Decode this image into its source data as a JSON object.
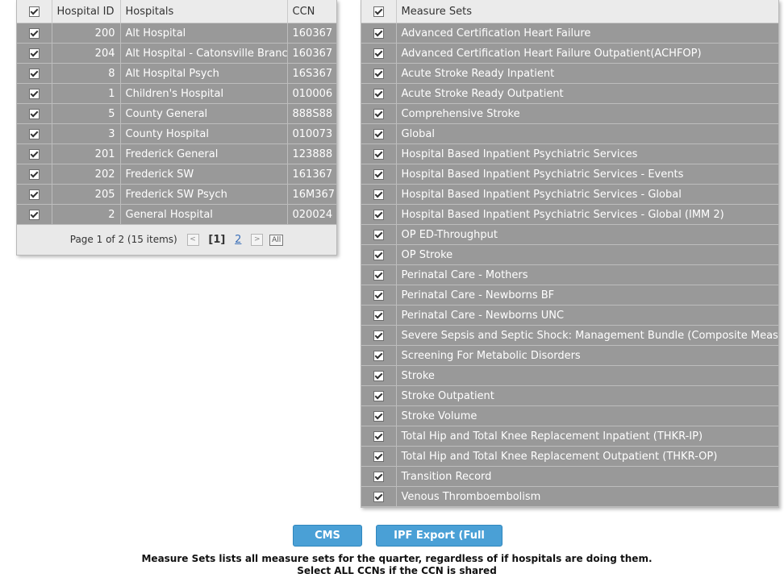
{
  "hospitals": {
    "columns": {
      "id": "Hospital ID",
      "name": "Hospitals",
      "ccn": "CCN"
    },
    "rows": [
      {
        "id": "200",
        "name": "Alt Hospital",
        "ccn": "160367"
      },
      {
        "id": "204",
        "name": "Alt Hospital - Catonsville Branch",
        "ccn": "160367"
      },
      {
        "id": "8",
        "name": "Alt Hospital Psych",
        "ccn": "16S367"
      },
      {
        "id": "1",
        "name": "Children's Hospital",
        "ccn": "010006"
      },
      {
        "id": "5",
        "name": "County General",
        "ccn": "888S88"
      },
      {
        "id": "3",
        "name": "County Hospital",
        "ccn": "010073"
      },
      {
        "id": "201",
        "name": "Frederick General",
        "ccn": "123888"
      },
      {
        "id": "202",
        "name": "Frederick SW",
        "ccn": "161367"
      },
      {
        "id": "205",
        "name": "Frederick SW Psych",
        "ccn": "16M367"
      },
      {
        "id": "2",
        "name": "General Hospital",
        "ccn": "020024"
      }
    ],
    "pager": {
      "info": "Page 1 of 2 (15 items)",
      "prev": "<",
      "current": "[1]",
      "next_page": "2",
      "next": ">",
      "all": "All"
    }
  },
  "measures": {
    "column": "Measure Sets",
    "rows": [
      "Advanced Certification Heart Failure",
      "Advanced Certification Heart Failure Outpatient(ACHFOP)",
      "Acute Stroke Ready Inpatient",
      "Acute Stroke Ready Outpatient",
      "Comprehensive Stroke",
      "Global",
      "Hospital Based Inpatient Psychiatric Services",
      "Hospital Based Inpatient Psychiatric Services - Events",
      "Hospital Based Inpatient Psychiatric Services - Global",
      "Hospital Based Inpatient Psychiatric Services - Global (IMM 2)",
      "OP ED-Throughput",
      "OP Stroke",
      "Perinatal Care - Mothers",
      "Perinatal Care - Newborns BF",
      "Perinatal Care - Newborns UNC",
      "Severe Sepsis and Septic Shock: Management Bundle (Composite Measure)",
      "Screening For Metabolic Disorders",
      "Stroke",
      "Stroke Outpatient",
      "Stroke Volume",
      "Total Hip and Total Knee Replacement Inpatient (THKR-IP)",
      "Total Hip and Total Knee Replacement Outpatient (THKR-OP)",
      "Transition Record",
      "Venous Thromboembolism"
    ]
  },
  "buttons": {
    "cms_export": "CMS Export",
    "ipf_export": "IPF Export (Full Year)"
  },
  "notes": {
    "line1": "Measure Sets lists all measure sets for the quarter, regardless of if hospitals are doing them.",
    "line2": "Select ALL CCNs if the CCN is shared"
  },
  "colors": {
    "row_bg": "#999999",
    "header_bg": "#ebebeb",
    "button_bg": "#4aa0d6",
    "link": "#3a6fb8"
  },
  "icons": {
    "checkbox": "checkbox-checked-icon",
    "prev": "chevron-left-icon",
    "next": "chevron-right-icon"
  }
}
